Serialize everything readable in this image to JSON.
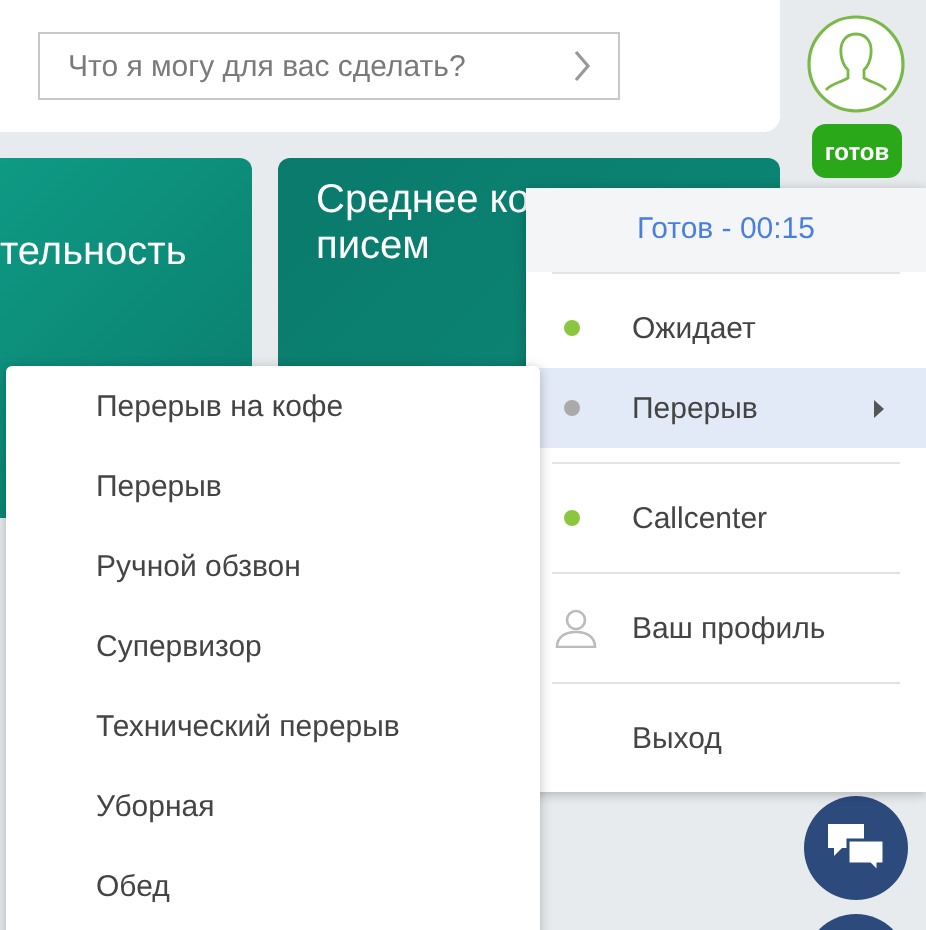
{
  "search": {
    "placeholder": "Что я могу для вас сделать?"
  },
  "agent": {
    "status_badge": "готов"
  },
  "cards": [
    {
      "title_lines": [
        "тельность"
      ]
    },
    {
      "title_lines": [
        "Среднее ко",
        "писем"
      ]
    }
  ],
  "status_menu": {
    "header": "Готов - 00:15",
    "groups": [
      [
        {
          "kind": "status",
          "label": "Ожидает",
          "color": "#8cc63f",
          "selected": false
        },
        {
          "kind": "status",
          "label": "Перерыв",
          "color": "#aaaaaa",
          "selected": true,
          "submenu": true
        }
      ],
      [
        {
          "kind": "status",
          "label": "Callcenter",
          "color": "#8cc63f",
          "selected": false
        }
      ],
      [
        {
          "kind": "profile",
          "label": "Ваш профиль",
          "selected": false
        }
      ],
      [
        {
          "kind": "plain",
          "label": "Выход",
          "selected": false
        }
      ]
    ]
  },
  "break_menu": {
    "items": [
      {
        "label": "Перерыв на кофе",
        "selected": false
      },
      {
        "label": "Перерыв",
        "selected": false
      },
      {
        "label": "Ручной обзвон",
        "selected": false
      },
      {
        "label": "Супервизор",
        "selected": false
      },
      {
        "label": "Технический перерыв",
        "selected": false
      },
      {
        "label": "Уборная",
        "selected": false
      },
      {
        "label": "Обед",
        "selected": false
      }
    ]
  }
}
